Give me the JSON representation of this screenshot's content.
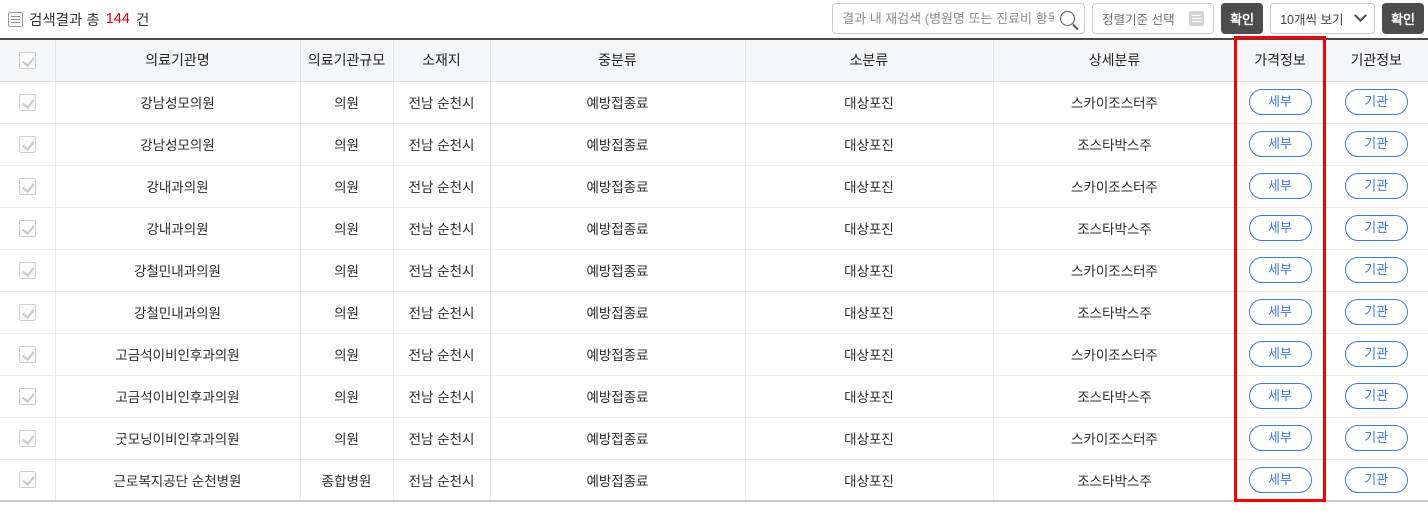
{
  "header": {
    "list_icon": "list-icon",
    "summary_prefix": "검색결과 총",
    "count": "144",
    "summary_suffix": "건"
  },
  "search": {
    "placeholder": "결과 내 재검색 (병원명 또는 진료비 항목)",
    "value": "",
    "search_icon": "search-icon",
    "sort_label": "정렬기준 선택",
    "sort_icon": "sort-list-icon",
    "sort_confirm_label": "확인",
    "perpage_label": "10개씩 보기",
    "perpage_chevron": "chevron-down-icon",
    "perpage_confirm_label": "확인"
  },
  "table": {
    "columns": [
      "",
      "의료기관명",
      "의료기관규모",
      "소재지",
      "중분류",
      "소분류",
      "상세분류",
      "가격정보",
      "기관정보"
    ],
    "price_button_label": "세부",
    "org_button_label": "기관",
    "rows": [
      {
        "name": "강남성모의원",
        "size": "의원",
        "region": "전남 순천시",
        "mid": "예방접종료",
        "sub": "대상포진",
        "detail": "스카이조스터주"
      },
      {
        "name": "강남성모의원",
        "size": "의원",
        "region": "전남 순천시",
        "mid": "예방접종료",
        "sub": "대상포진",
        "detail": "조스타박스주"
      },
      {
        "name": "강내과의원",
        "size": "의원",
        "region": "전남 순천시",
        "mid": "예방접종료",
        "sub": "대상포진",
        "detail": "스카이조스터주"
      },
      {
        "name": "강내과의원",
        "size": "의원",
        "region": "전남 순천시",
        "mid": "예방접종료",
        "sub": "대상포진",
        "detail": "조스타박스주"
      },
      {
        "name": "강철민내과의원",
        "size": "의원",
        "region": "전남 순천시",
        "mid": "예방접종료",
        "sub": "대상포진",
        "detail": "스카이조스터주"
      },
      {
        "name": "강철민내과의원",
        "size": "의원",
        "region": "전남 순천시",
        "mid": "예방접종료",
        "sub": "대상포진",
        "detail": "조스타박스주"
      },
      {
        "name": "고금석이비인후과의원",
        "size": "의원",
        "region": "전남 순천시",
        "mid": "예방접종료",
        "sub": "대상포진",
        "detail": "스카이조스터주"
      },
      {
        "name": "고금석이비인후과의원",
        "size": "의원",
        "region": "전남 순천시",
        "mid": "예방접종료",
        "sub": "대상포진",
        "detail": "조스타박스주"
      },
      {
        "name": "굿모닝이비인후과의원",
        "size": "의원",
        "region": "전남 순천시",
        "mid": "예방접종료",
        "sub": "대상포진",
        "detail": "스카이조스터주"
      },
      {
        "name": "근로복지공단 순천병원",
        "size": "종합병원",
        "region": "전남 순천시",
        "mid": "예방접종료",
        "sub": "대상포진",
        "detail": "조스타박스주"
      }
    ]
  },
  "colors": {
    "highlight_border": "#fb0000",
    "pill_blue": "#3c7ae4",
    "count_red": "#e8000d",
    "confirm_dark": "#4c4c4c"
  }
}
